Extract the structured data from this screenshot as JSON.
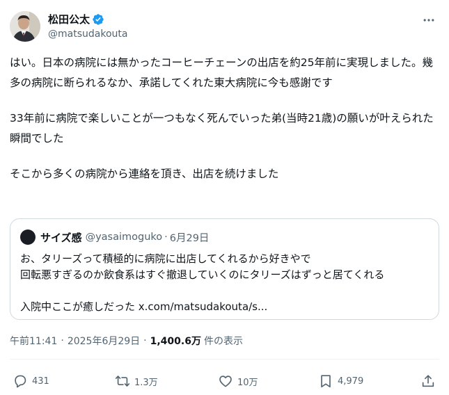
{
  "author": {
    "display_name": "松田公太",
    "handle": "@matsudakouta",
    "avatar_icon": "profile-photo",
    "verified_icon": "verified-badge-icon",
    "verified_color": "#1d9bf0"
  },
  "more_icon": "more-horizontal-icon",
  "tweet": {
    "paragraphs": [
      "はい。日本の病院には無かったコーヒーチェーンの出店を約25年前に実現しました。幾多の病院に断られるなか、承諾してくれた東大病院に今も感謝です",
      "33年前に病院で楽しいことが一つもなく死んでいった弟(当時21歳)の願いが叶えられた瞬間でした",
      "そこから多くの病院から連絡を頂き、出店を続けました"
    ]
  },
  "quote": {
    "name": "サイズ感",
    "handle": "@yasaimoguko",
    "separator": "·",
    "date": "6月29日",
    "lines": [
      "お、タリーズって積極的に病院に出店してくれるから好きやで",
      "回転悪すぎるのか飲食系はすぐ撤退していくのにタリーズはずっと居てくれる"
    ],
    "last_line": "入院中ここが癒しだった x.com/matsudakouta/s..."
  },
  "meta": {
    "time": "午前11:41",
    "date": "2025年6月29日",
    "separator": "·",
    "views_count": "1,400.6万",
    "views_label": "件の表示"
  },
  "actions": {
    "replies": {
      "icon": "reply-icon",
      "count": "431"
    },
    "reposts": {
      "icon": "repost-icon",
      "count": "1.3万"
    },
    "likes": {
      "icon": "heart-icon",
      "count": "10万"
    },
    "bookmarks": {
      "icon": "bookmark-icon",
      "count": "4,979"
    },
    "share": {
      "icon": "share-icon"
    }
  },
  "colors": {
    "text": "#0f1419",
    "secondary": "#536471",
    "border": "#cfd9de"
  }
}
